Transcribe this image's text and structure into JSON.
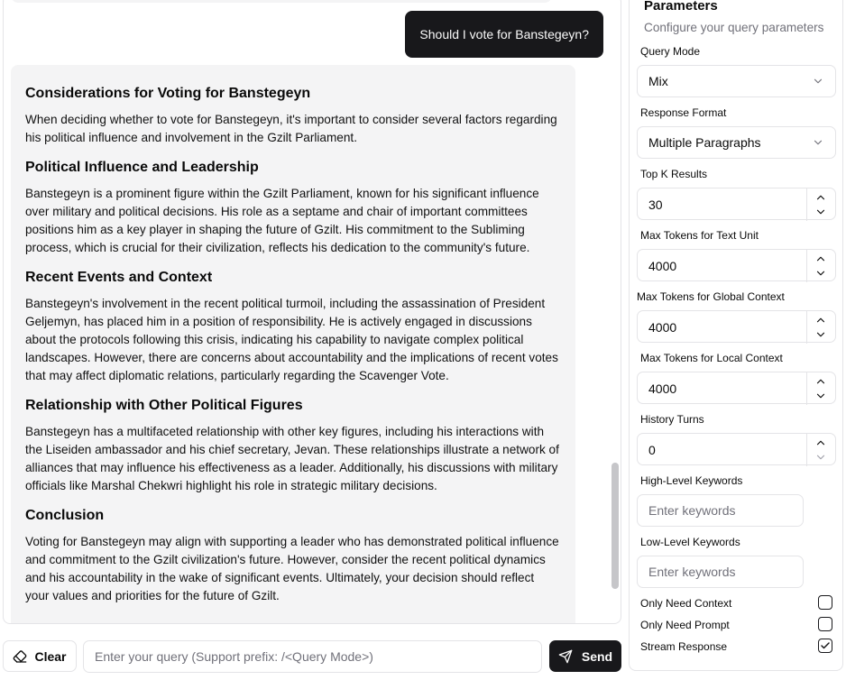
{
  "chat": {
    "user_message": "Should I vote for Banstegeyn?",
    "answer": {
      "heading_1": "Considerations for Voting for Banstegeyn",
      "para_1": "When deciding whether to vote for Banstegeyn, it's important to consider several factors regarding his political influence and involvement in the Gzilt Parliament.",
      "heading_2": "Political Influence and Leadership",
      "para_2": "Banstegeyn is a prominent figure within the Gzilt Parliament, known for his significant influence over military and political decisions. His role as a septame and chair of important committees positions him as a key player in shaping the future of Gzilt. His commitment to the Subliming process, which is crucial for their civilization, reflects his dedication to the community's future.",
      "heading_3": "Recent Events and Context",
      "para_3": "Banstegeyn's involvement in the recent political turmoil, including the assassination of President Geljemyn, has placed him in a position of responsibility. He is actively engaged in discussions about the protocols following this crisis, indicating his capability to navigate complex political landscapes. However, there are concerns about accountability and the implications of recent votes that may affect diplomatic relations, particularly regarding the Scavenger Vote.",
      "heading_4": "Relationship with Other Political Figures",
      "para_4": "Banstegeyn has a multifaceted relationship with other key figures, including his interactions with the Liseiden ambassador and his chief secretary, Jevan. These relationships illustrate a network of alliances that may influence his effectiveness as a leader. Additionally, his discussions with military officials like Marshal Chekwri highlight his role in strategic military decisions.",
      "heading_5": "Conclusion",
      "para_5": "Voting for Banstegeyn may align with supporting a leader who has demonstrated political influence and commitment to the Gzilt civilization's future. However, consider the recent political dynamics and his accountability in the wake of significant events. Ultimately, your decision should reflect your values and priorities for the future of Gzilt."
    }
  },
  "input_bar": {
    "clear_label": "Clear",
    "query_placeholder": "Enter your query (Support prefix: /<Query Mode>)",
    "query_value": "",
    "send_label": "Send"
  },
  "params": {
    "title": "Parameters",
    "description": "Configure your query parameters",
    "query_mode_label": "Query Mode",
    "query_mode_value": "Mix",
    "response_format_label": "Response Format",
    "response_format_value": "Multiple Paragraphs",
    "top_k_label": "Top K Results",
    "top_k_value": "30",
    "max_tokens_text_label": "Max Tokens for Text Unit",
    "max_tokens_text_value": "4000",
    "max_tokens_global_label": "Max Tokens for Global Context",
    "max_tokens_global_value": "4000",
    "max_tokens_local_label": "Max Tokens for Local Context",
    "max_tokens_local_value": "4000",
    "history_turns_label": "History Turns",
    "history_turns_value": "0",
    "high_level_label": "High-Level Keywords",
    "high_level_placeholder": "Enter keywords",
    "low_level_label": "Low-Level Keywords",
    "low_level_placeholder": "Enter keywords",
    "only_context_label": "Only Need Context",
    "only_context_checked": false,
    "only_prompt_label": "Only Need Prompt",
    "only_prompt_checked": false,
    "stream_label": "Stream Response",
    "stream_checked": true
  },
  "colors": {
    "primary_dark": "#18181b",
    "bubble_bg": "#f4f4f5",
    "border": "#e4e4e7",
    "muted_text": "#71717a"
  },
  "icons": {
    "clear": "eraser-icon",
    "send": "send-icon",
    "dropdown": "chevron-down-icon",
    "stepper_up": "chevron-up-icon",
    "stepper_down": "chevron-down-icon",
    "checked": "check-icon"
  }
}
